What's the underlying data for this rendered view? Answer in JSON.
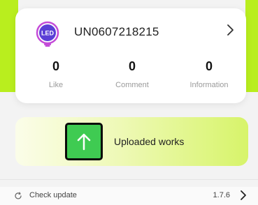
{
  "profile": {
    "username": "UN0607218215",
    "avatar_text": "LED",
    "stats": [
      {
        "value": "0",
        "label": "Like"
      },
      {
        "value": "0",
        "label": "Comment"
      },
      {
        "value": "0",
        "label": "Information"
      }
    ]
  },
  "upload": {
    "label": "Uploaded works",
    "icon": "upload-arrow-icon"
  },
  "update": {
    "label": "Check update",
    "version": "1.7.6",
    "icon": "refresh-icon"
  },
  "colors": {
    "accent_green": "#b9ee1e",
    "upload_icon_bg": "#3fcb52",
    "avatar_purple": "#5b3fd6"
  }
}
